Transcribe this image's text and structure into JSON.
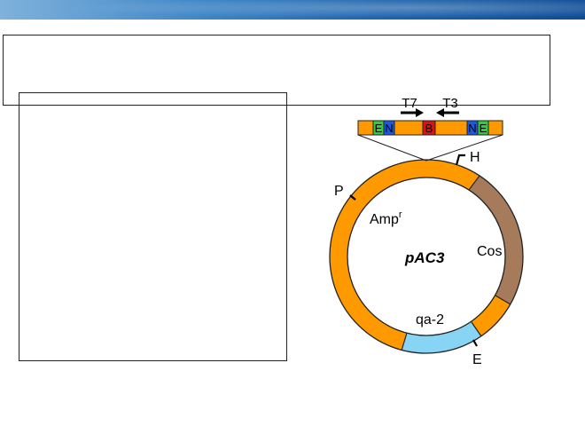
{
  "slide": {
    "title_box_text": "",
    "content_box_text": ""
  },
  "plasmid": {
    "name": "pAC3",
    "colors": {
      "backbone": "#ff9900",
      "cos": "#a67b5b",
      "qa2": "#87d4f5",
      "site_green": "#2ecc40",
      "site_blue": "#1e58e0",
      "site_red": "#dd1111"
    },
    "labels": {
      "ampr_base": "Amp",
      "ampr_sup": "r",
      "cos": "Cos",
      "qa2": "qa-2",
      "P": "P",
      "H": "H",
      "E": "E"
    },
    "insert": {
      "primers": {
        "left": "T7",
        "right": "T3"
      },
      "sites": {
        "E1": "E",
        "N1": "N",
        "B": "B",
        "N2": "N",
        "E2": "E"
      }
    }
  }
}
